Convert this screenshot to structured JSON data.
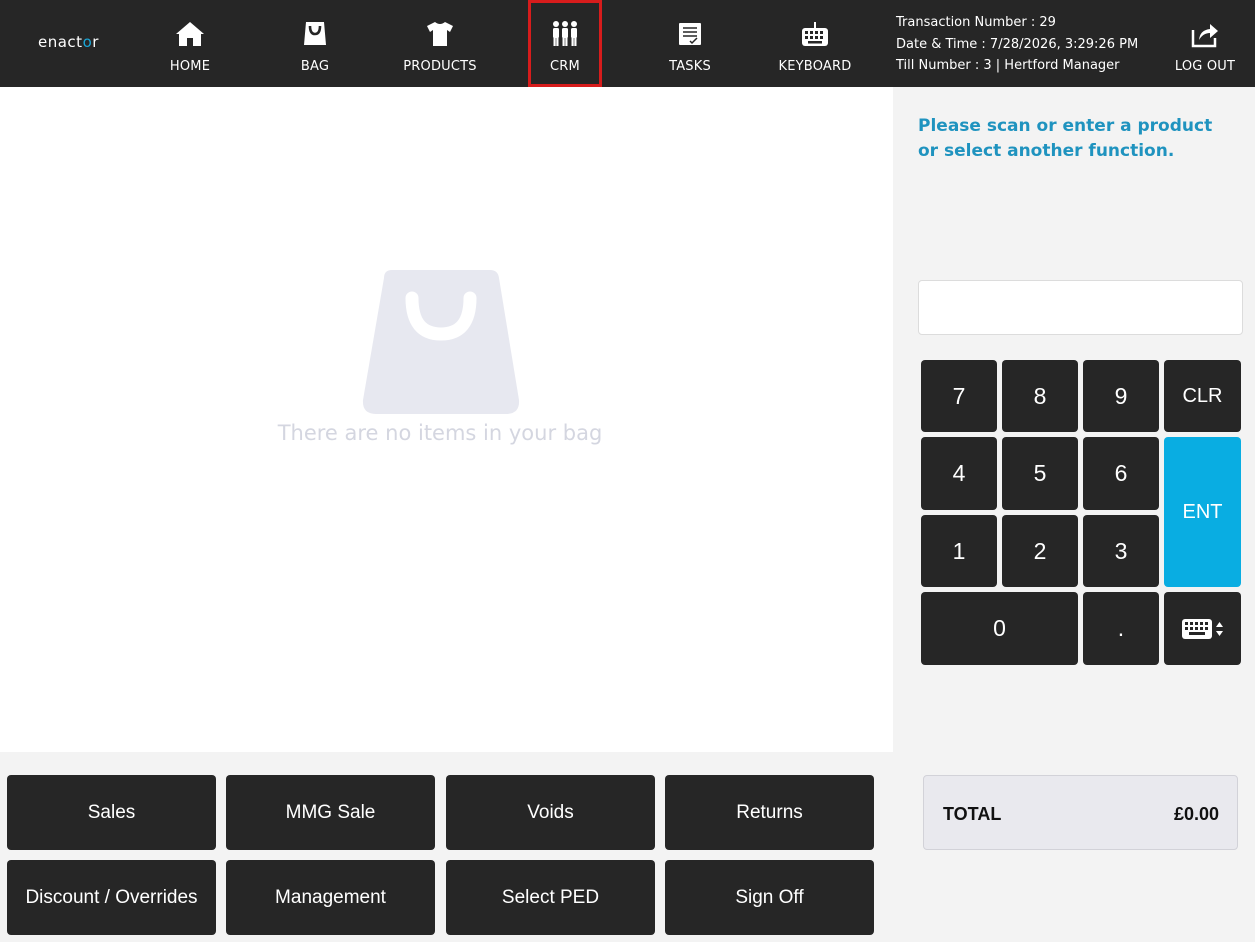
{
  "brand": {
    "logo_text_pre": "enact",
    "logo_text_dot": "o",
    "logo_text_post": "r"
  },
  "nav": [
    {
      "label": "HOME",
      "icon": "home-icon"
    },
    {
      "label": "BAG",
      "icon": "bag-icon"
    },
    {
      "label": "PRODUCTS",
      "icon": "shirt-icon"
    },
    {
      "label": "CRM",
      "icon": "people-icon",
      "highlighted": true
    },
    {
      "label": "TASKS",
      "icon": "tasks-icon"
    },
    {
      "label": "KEYBOARD",
      "icon": "keyboard-icon"
    },
    {
      "label": "LOG OUT",
      "icon": "logout-icon"
    }
  ],
  "transaction": {
    "number_line": "Transaction Number : 29",
    "datetime_line": "Date & Time : 7/28/2026, 3:29:26 PM",
    "till_line": "Till Number : 3 | Hertford Manager"
  },
  "bag": {
    "empty_text": "There are no items in your bag"
  },
  "prompt": {
    "text": "Please scan or enter a product or select another function."
  },
  "entry": {
    "value": "",
    "placeholder": ""
  },
  "keypad": {
    "k7": "7",
    "k8": "8",
    "k9": "9",
    "clr": "CLR",
    "k4": "4",
    "k5": "5",
    "k6": "6",
    "ent": "ENT",
    "k1": "1",
    "k2": "2",
    "k3": "3",
    "k0": "0",
    "dot": ".",
    "keyboard_toggle_icon": "keyboard-toggle-icon"
  },
  "total": {
    "label": "TOTAL",
    "value": "£0.00"
  },
  "functions": {
    "sales": "Sales",
    "mmg_sale": "MMG Sale",
    "voids": "Voids",
    "returns": "Returns",
    "discount": "Discount / Overrides",
    "management": "Management",
    "select_ped": "Select PED",
    "sign_off": "Sign Off"
  },
  "colors": {
    "topbar": "#262626",
    "accent": "#09ade2",
    "prompt": "#1f93bf",
    "highlight": "#d71c1c"
  }
}
